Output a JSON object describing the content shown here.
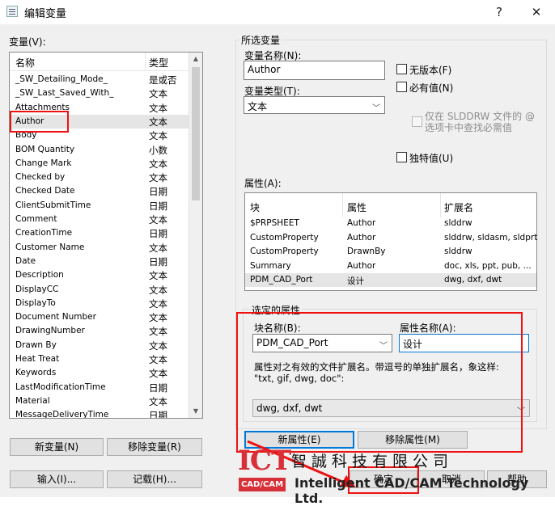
{
  "window": {
    "title": "编辑变量",
    "help_btn": "?",
    "close_btn": "✕"
  },
  "variables": {
    "label": "变量(V):",
    "col_name": "名称",
    "col_type": "类型",
    "items": [
      {
        "name": "_SW_Detailing_Mode_",
        "type": "是或否"
      },
      {
        "name": "_SW_Last_Saved_With_",
        "type": "文本"
      },
      {
        "name": "Attachments",
        "type": "文本"
      },
      {
        "name": "Author",
        "type": "文本"
      },
      {
        "name": "Body",
        "type": "文本"
      },
      {
        "name": "BOM Quantity",
        "type": "小数"
      },
      {
        "name": "Change Mark",
        "type": "文本"
      },
      {
        "name": "Checked by",
        "type": "文本"
      },
      {
        "name": "Checked Date",
        "type": "日期"
      },
      {
        "name": "ClientSubmitTime",
        "type": "日期"
      },
      {
        "name": "Comment",
        "type": "文本"
      },
      {
        "name": "CreationTime",
        "type": "日期"
      },
      {
        "name": "Customer Name",
        "type": "文本"
      },
      {
        "name": "Date",
        "type": "日期"
      },
      {
        "name": "Description",
        "type": "文本"
      },
      {
        "name": "DisplayCC",
        "type": "文本"
      },
      {
        "name": "DisplayTo",
        "type": "文本"
      },
      {
        "name": "Document Number",
        "type": "文本"
      },
      {
        "name": "DrawingNumber",
        "type": "文本"
      },
      {
        "name": "Drawn By",
        "type": "文本"
      },
      {
        "name": "Heat Treat",
        "type": "文本"
      },
      {
        "name": "Keywords",
        "type": "文本"
      },
      {
        "name": "LastModificationTime",
        "type": "日期"
      },
      {
        "name": "Material",
        "type": "文本"
      },
      {
        "name": "MessageDeliveryTime",
        "type": "日期"
      }
    ],
    "new_btn": "新变量(N)",
    "remove_btn": "移除变量(R)",
    "import_btn": "输入(I)...",
    "log_btn": "记载(H)..."
  },
  "selected_variable": {
    "group_title": "所选变量",
    "name_label": "变量名称(N):",
    "name_value": "Author",
    "type_label": "变量类型(T):",
    "type_value": "文本",
    "no_version": "无版本(F)",
    "required": "必有值(N)",
    "slddrw_only": "仅在 SLDDRW 文件的 @ 选项卡中查找必需值",
    "unique": "独特值(U)"
  },
  "attributes": {
    "label": "属性(A):",
    "col_block": "块",
    "col_attr": "属性",
    "col_ext": "扩展名",
    "rows": [
      {
        "block": "$PRPSHEET",
        "attr": "Author",
        "ext": "slddrw"
      },
      {
        "block": "CustomProperty",
        "attr": "Author",
        "ext": "slddrw, sldasm, sldprt"
      },
      {
        "block": "CustomProperty",
        "attr": "DrawnBy",
        "ext": "slddrw"
      },
      {
        "block": "Summary",
        "attr": "Author",
        "ext": "doc, xls, ppt, pub, ..."
      },
      {
        "block": "PDM_CAD_Port",
        "attr": "设计",
        "ext": "dwg, dxf, dwt"
      }
    ]
  },
  "selected_attribute": {
    "group_title": "选定的属性",
    "block_label": "块名称(B):",
    "block_value": "PDM_CAD_Port",
    "attr_label": "属性名称(A):",
    "attr_value": "设计",
    "ext_hint": "属性对之有效的文件扩展名。带逗号的单独扩展名，象这样: \"txt, gif, dwg, doc\":",
    "ext_value": "dwg, dxf, dwt",
    "new_btn": "新属性(E)",
    "remove_btn": "移除属性(M)"
  },
  "footer": {
    "ok_btn": "确定",
    "cancel_btn": "取消",
    "help_btn": "帮助"
  },
  "watermark": {
    "logo_big": "ICT",
    "logo_small": "CAD/CAM",
    "company_cn": "智誠科技有限公司",
    "company_en": "Intelligent CAD/CAM Technology Ltd."
  },
  "colors": {
    "annotation": "#e11111",
    "focus": "#0078d7",
    "logo": "#d83038"
  }
}
